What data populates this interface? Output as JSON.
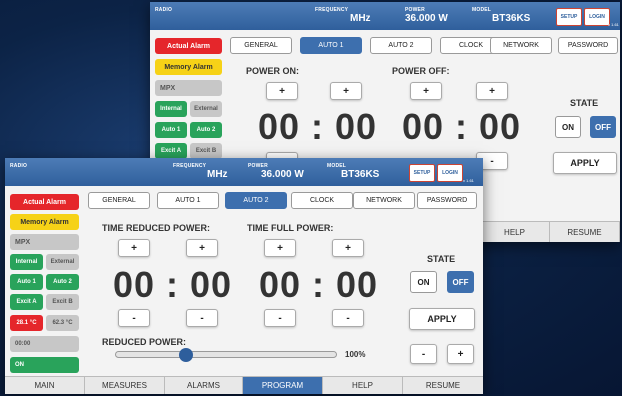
{
  "back": {
    "header": {
      "radio_label": "RADIO",
      "frequency_label": "FREQUENCY",
      "frequency_value": "MHz",
      "power_label": "POWER",
      "power_value": "36.000 W",
      "model_label": "MODEL",
      "model_value": "BT36KS",
      "setup": "SETUP",
      "login": "LOGIN",
      "version": "v 1.61"
    },
    "side": [
      "Actual Alarm",
      "Memory Alarm",
      "MPX",
      "Internal",
      "External",
      "Auto 1",
      "Auto 2",
      "Excit A",
      "Excit B"
    ],
    "tabs": [
      "GENERAL",
      "AUTO 1",
      "AUTO 2",
      "CLOCK",
      "NETWORK",
      "PASSWORD"
    ],
    "active_tab": "AUTO 1",
    "power_on_label": "POWER ON:",
    "power_off_label": "POWER OFF:",
    "plus": "+",
    "minus": "-",
    "time_on": "00 : 00",
    "time_off": "00 : 00",
    "state_label": "STATE",
    "state_on": "ON",
    "state_off": "OFF",
    "apply": "APPLY",
    "nav": [
      "HELP",
      "RESUME"
    ]
  },
  "front": {
    "header": {
      "radio_label": "RADIO",
      "frequency_label": "FREQUENCY",
      "frequency_value": "MHz",
      "power_label": "POWER",
      "power_value": "36.000 W",
      "model_label": "MODEL",
      "model_value": "BT36KS",
      "setup": "SETUP",
      "login": "LOGIN",
      "version": "v 1.61"
    },
    "side": {
      "actual_alarm": "Actual Alarm",
      "memory_alarm": "Memory Alarm",
      "mpx": "MPX",
      "internal": "Internal",
      "external": "External",
      "auto1": "Auto 1",
      "auto2": "Auto 2",
      "excit_a": "Excit A",
      "excit_b": "Excit B",
      "temp1": "28.1 °C",
      "temp2": "62.3 °C",
      "clock": "00:00",
      "on": "ON"
    },
    "tabs": [
      "GENERAL",
      "AUTO 1",
      "AUTO 2",
      "CLOCK",
      "NETWORK",
      "PASSWORD"
    ],
    "active_tab": "AUTO 2",
    "time_reduced_label": "TIME REDUCED POWER:",
    "time_full_label": "TIME FULL POWER:",
    "plus": "+",
    "minus": "-",
    "time_reduced": "00 : 00",
    "time_full": "00 : 00",
    "state_label": "STATE",
    "state_on": "ON",
    "state_off": "OFF",
    "apply": "APPLY",
    "reduced_power_label": "REDUCED POWER:",
    "reduced_power_percent": "100%",
    "reduced_power_slider_fraction": 0.32,
    "nav": [
      "MAIN",
      "MEASURES",
      "ALARMS",
      "PROGRAM",
      "HELP",
      "RESUME"
    ],
    "active_nav": "PROGRAM"
  },
  "colors": {
    "header_blue": "#3d6fae",
    "alarm_red": "#e5262b",
    "memory_yellow": "#f6d217",
    "status_green": "#29a35b",
    "inactive_grey": "#c7c7c7",
    "background_navy": "#0c2346"
  }
}
